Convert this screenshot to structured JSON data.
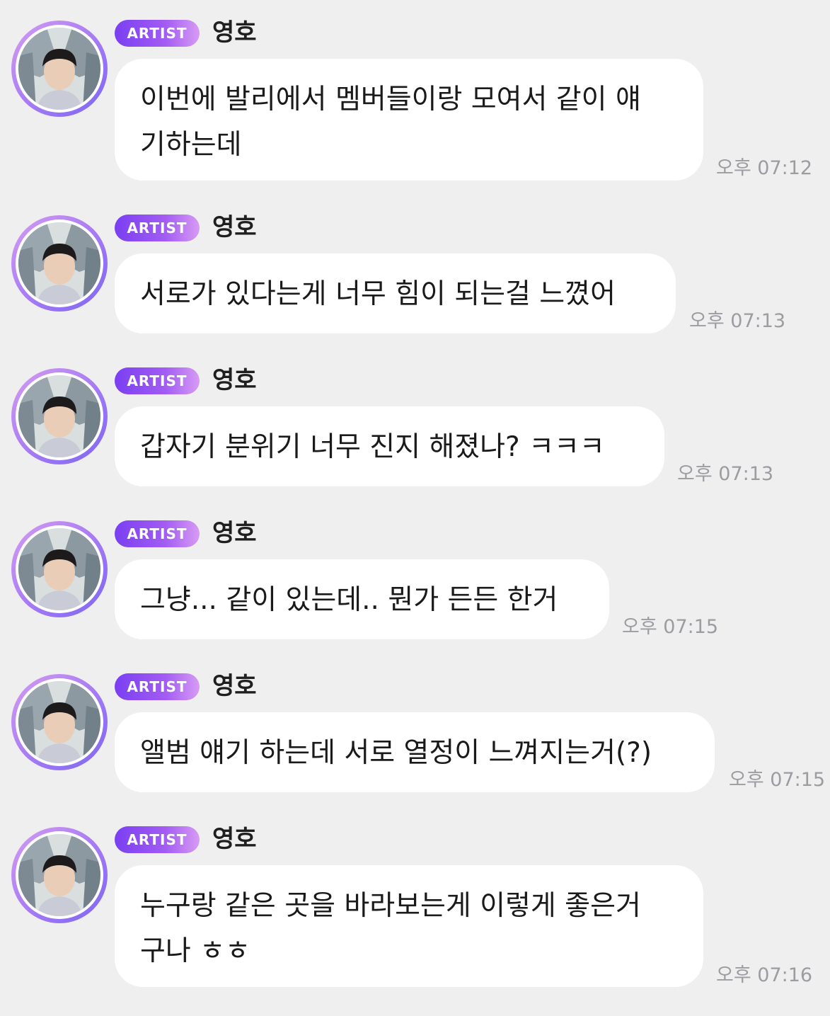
{
  "artist_badge": "ARTIST",
  "messages": [
    {
      "sender": "영호",
      "badge": "ARTIST",
      "text": "이번에 발리에서 멤버들이랑 모여서 같이 얘\n기하는데",
      "time": "오후 07:12"
    },
    {
      "sender": "영호",
      "badge": "ARTIST",
      "text": "서로가 있다는게 너무 힘이 되는걸 느꼈어",
      "time": "오후 07:13"
    },
    {
      "sender": "영호",
      "badge": "ARTIST",
      "text": "갑자기 분위기 너무 진지 해졌나? ㅋㅋㅋ",
      "time": "오후 07:13"
    },
    {
      "sender": "영호",
      "badge": "ARTIST",
      "text": "그냥... 같이 있는데.. 뭔가 든든 한거",
      "time": "오후 07:15"
    },
    {
      "sender": "영호",
      "badge": "ARTIST",
      "text": "앨범 얘기 하는데 서로 열정이 느껴지는거(?)",
      "time": "오후 07:15"
    },
    {
      "sender": "영호",
      "badge": "ARTIST",
      "text": "누구랑 같은 곳을 바라보는게 이렇게 좋은거\n구나 ㅎㅎ",
      "time": "오후 07:16"
    }
  ],
  "colors": {
    "background": "#efeff0",
    "bubble": "#ffffff",
    "badge_start": "#7a3ff2",
    "badge_end": "#d79bf3",
    "time": "#9c9ca1"
  },
  "icons": {
    "avatar": "artist-avatar-photo"
  }
}
